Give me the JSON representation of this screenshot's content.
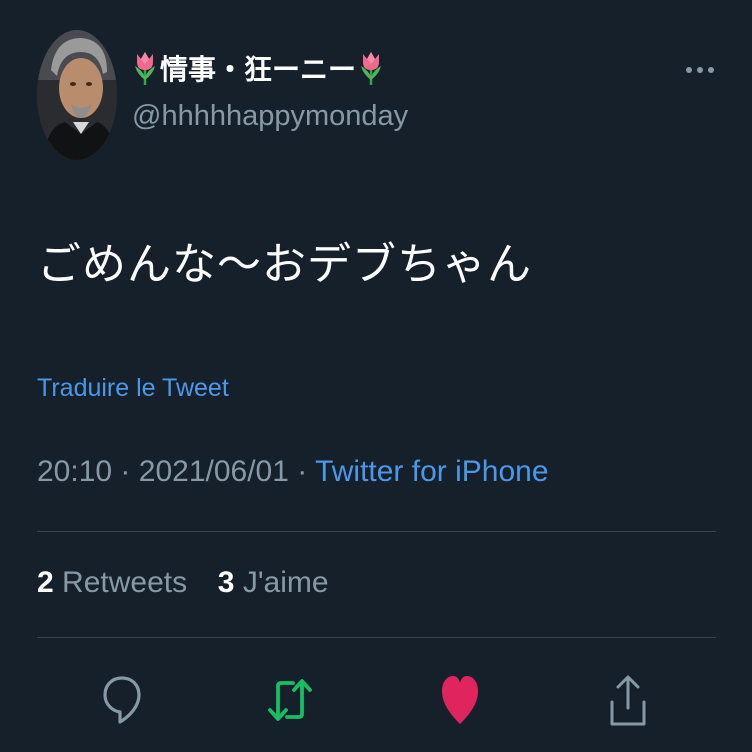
{
  "user": {
    "display_name": "情事・狂ーニー",
    "handle": "@hhhhhappymonday"
  },
  "tweet": {
    "text": "ごめんな〜おデブちゃん",
    "translate_label": "Traduire le Tweet",
    "time": "20:10",
    "separator": "·",
    "date": "2021/06/01",
    "source": "Twitter for iPhone"
  },
  "stats": {
    "retweets_count": "2",
    "retweets_label": "Retweets",
    "likes_count": "3",
    "likes_label": "J'aime"
  },
  "icons": {
    "more": "more-horizontal-icon",
    "reply": "reply-icon",
    "retweet": "retweet-icon",
    "like": "heart-icon",
    "share": "share-icon",
    "name_decoration": "tulip-icon"
  },
  "colors": {
    "background": "#15202b",
    "link": "#4a99e9",
    "muted": "#8899a6",
    "retweet": "#17bf63",
    "like": "#e0245e"
  }
}
